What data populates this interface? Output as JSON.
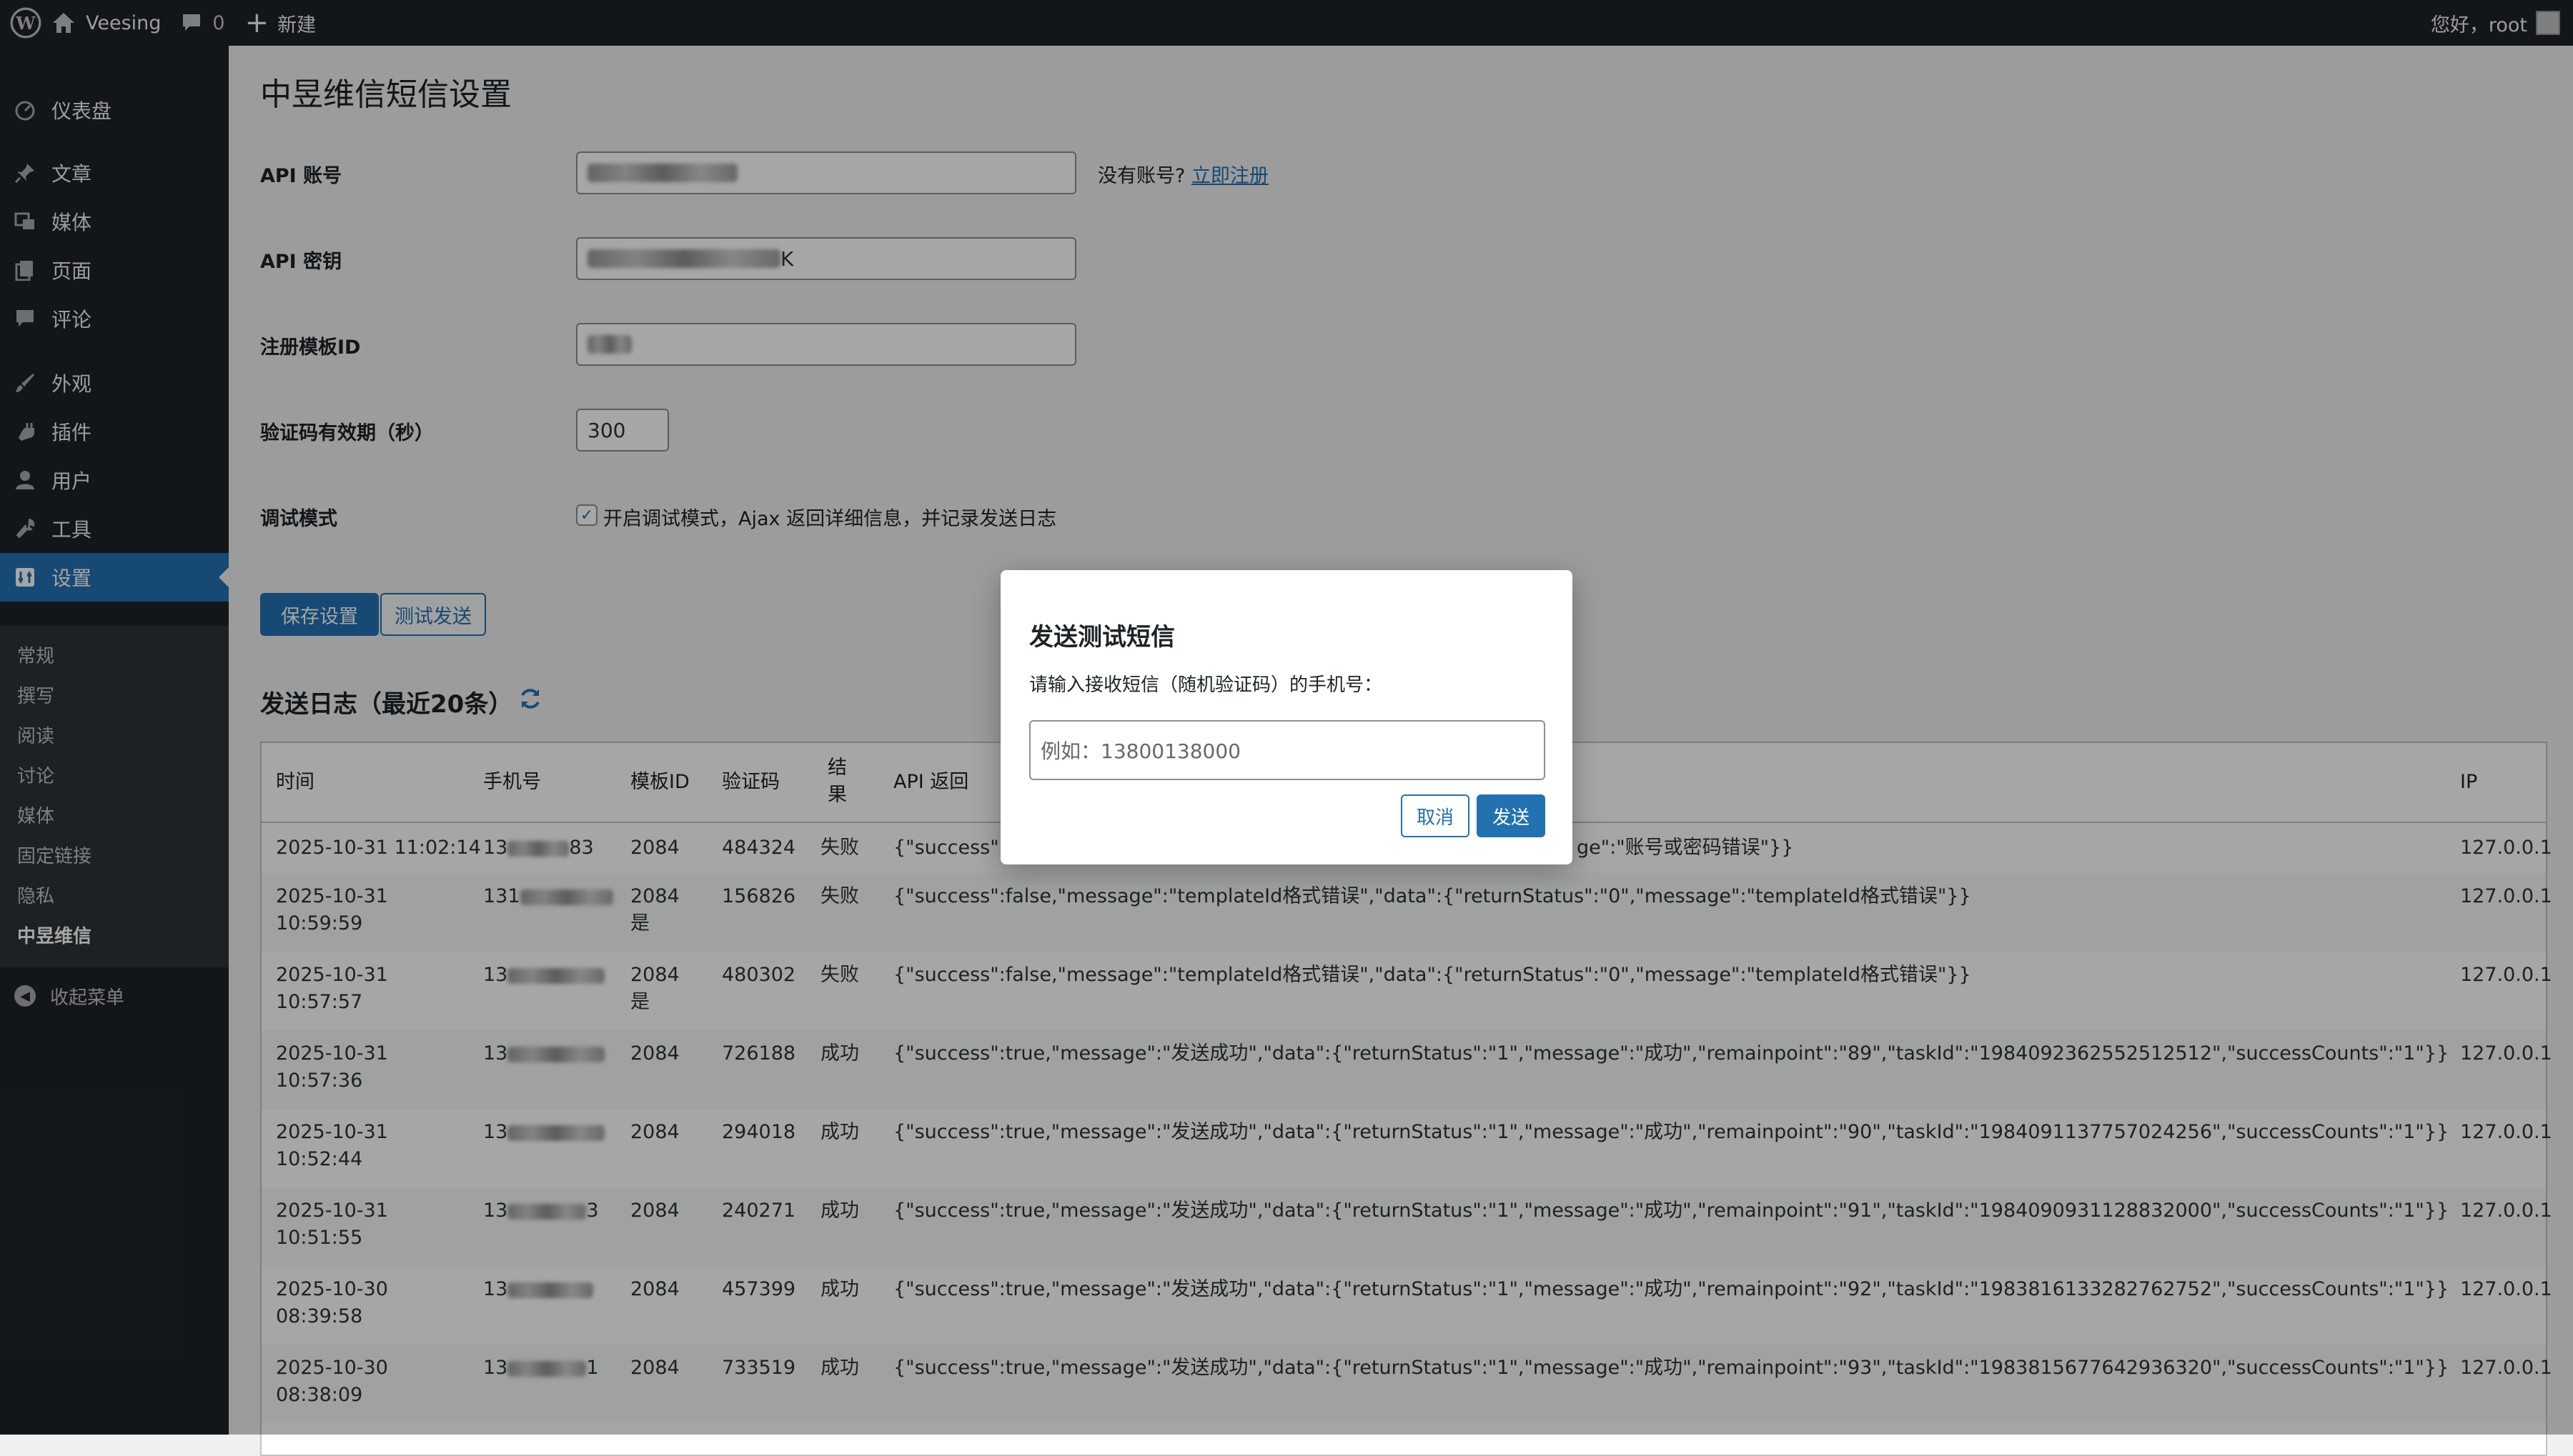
{
  "adminbar": {
    "site_name": "Veesing",
    "comments_count": "0",
    "new_label": "新建",
    "greeting": "您好，root"
  },
  "sidebar": {
    "items": [
      {
        "label": "仪表盘",
        "icon": "dashboard-icon"
      },
      {
        "label": "文章",
        "icon": "pin-icon"
      },
      {
        "label": "媒体",
        "icon": "media-icon"
      },
      {
        "label": "页面",
        "icon": "page-icon"
      },
      {
        "label": "评论",
        "icon": "comment-icon"
      },
      {
        "label": "外观",
        "icon": "brush-icon"
      },
      {
        "label": "插件",
        "icon": "plugin-icon"
      },
      {
        "label": "用户",
        "icon": "user-icon"
      },
      {
        "label": "工具",
        "icon": "wrench-icon"
      },
      {
        "label": "设置",
        "icon": "settings-icon"
      }
    ],
    "submenu": [
      "常规",
      "撰写",
      "阅读",
      "讨论",
      "媒体",
      "固定链接",
      "隐私",
      "中昱维信"
    ],
    "collapse_label": "收起菜单"
  },
  "page": {
    "title": "中昱维信短信设置",
    "api_account_label": "API 账号",
    "api_key_label": "API 密钥",
    "api_key_tail": "K",
    "template_label": "注册模板ID",
    "expiry_label": "验证码有效期（秒）",
    "expiry_value": "300",
    "debug_label": "调试模式",
    "debug_checkbox_label": "开启调试模式，Ajax 返回详细信息，并记录发送日志",
    "no_account_text": "没有账号?",
    "register_link": "立即注册",
    "save_button": "保存设置",
    "test_button": "测试发送",
    "log_title": "发送日志（最近20条）"
  },
  "log_table": {
    "headers": [
      "时间",
      "手机号",
      "模板ID",
      "验证码",
      "结果",
      "API 返回",
      "IP"
    ],
    "rows": [
      {
        "time1": "2025-10-31 11:02:14",
        "time2": "",
        "phone_pre": "13",
        "phone_suf": "83",
        "tpl1": "2084",
        "tpl2": "",
        "code": "484324",
        "result": "失败",
        "api_left": "{\"success\":fa",
        "api_right": "ge\":\"账号或密码错误\"}}",
        "ip": "127.0.0.1"
      },
      {
        "time1": "2025-10-31",
        "time2": "10:59:59",
        "phone_pre": "131",
        "phone_suf": "",
        "tpl1": "2084",
        "tpl2": "是",
        "code": "156826",
        "result": "失败",
        "api": "{\"success\":false,\"message\":\"templateId格式错误\",\"data\":{\"returnStatus\":\"0\",\"message\":\"templateId格式错误\"}}",
        "ip": "127.0.0.1"
      },
      {
        "time1": "2025-10-31",
        "time2": "10:57:57",
        "phone_pre": "13",
        "phone_suf": "",
        "tpl1": "2084",
        "tpl2": "是",
        "code": "480302",
        "result": "失败",
        "api": "{\"success\":false,\"message\":\"templateId格式错误\",\"data\":{\"returnStatus\":\"0\",\"message\":\"templateId格式错误\"}}",
        "ip": "127.0.0.1"
      },
      {
        "time1": "2025-10-31",
        "time2": "10:57:36",
        "phone_pre": "13",
        "phone_suf": "",
        "tpl1": "2084",
        "tpl2": "",
        "code": "726188",
        "result": "成功",
        "api": "{\"success\":true,\"message\":\"发送成功\",\"data\":{\"returnStatus\":\"1\",\"message\":\"成功\",\"remainpoint\":\"89\",\"taskId\":\"1984092362552512512\",\"successCounts\":\"1\"}}",
        "ip": "127.0.0.1"
      },
      {
        "time1": "2025-10-31",
        "time2": "10:52:44",
        "phone_pre": "13",
        "phone_suf": "",
        "tpl1": "2084",
        "tpl2": "",
        "code": "294018",
        "result": "成功",
        "api": "{\"success\":true,\"message\":\"发送成功\",\"data\":{\"returnStatus\":\"1\",\"message\":\"成功\",\"remainpoint\":\"90\",\"taskId\":\"1984091137757024256\",\"successCounts\":\"1\"}}",
        "ip": "127.0.0.1"
      },
      {
        "time1": "2025-10-31",
        "time2": "10:51:55",
        "phone_pre": "13",
        "phone_suf": "3",
        "tpl1": "2084",
        "tpl2": "",
        "code": "240271",
        "result": "成功",
        "api": "{\"success\":true,\"message\":\"发送成功\",\"data\":{\"returnStatus\":\"1\",\"message\":\"成功\",\"remainpoint\":\"91\",\"taskId\":\"1984090931128832000\",\"successCounts\":\"1\"}}",
        "ip": "127.0.0.1"
      },
      {
        "time1": "2025-10-30",
        "time2": "08:39:58",
        "phone_pre": "13",
        "phone_suf": "",
        "tpl1": "2084",
        "tpl2": "",
        "code": "457399",
        "result": "成功",
        "api": "{\"success\":true,\"message\":\"发送成功\",\"data\":{\"returnStatus\":\"1\",\"message\":\"成功\",\"remainpoint\":\"92\",\"taskId\":\"1983816133282762752\",\"successCounts\":\"1\"}}",
        "ip": "127.0.0.1"
      },
      {
        "time1": "2025-10-30",
        "time2": "08:38:09",
        "phone_pre": "13",
        "phone_suf": "1",
        "tpl1": "2084",
        "tpl2": "",
        "code": "733519",
        "result": "成功",
        "api": "{\"success\":true,\"message\":\"发送成功\",\"data\":{\"returnStatus\":\"1\",\"message\":\"成功\",\"remainpoint\":\"93\",\"taskId\":\"1983815677642936320\",\"successCounts\":\"1\"}}",
        "ip": "127.0.0.1"
      }
    ]
  },
  "modal": {
    "title": "发送测试短信",
    "description": "请输入接收短信（随机验证码）的手机号：",
    "placeholder": "例如：13800138000",
    "cancel": "取消",
    "send": "发送"
  },
  "colors": {
    "admin_dark": "#1d2327",
    "accent": "#2271b1",
    "page_bg": "#f0f0f1"
  }
}
